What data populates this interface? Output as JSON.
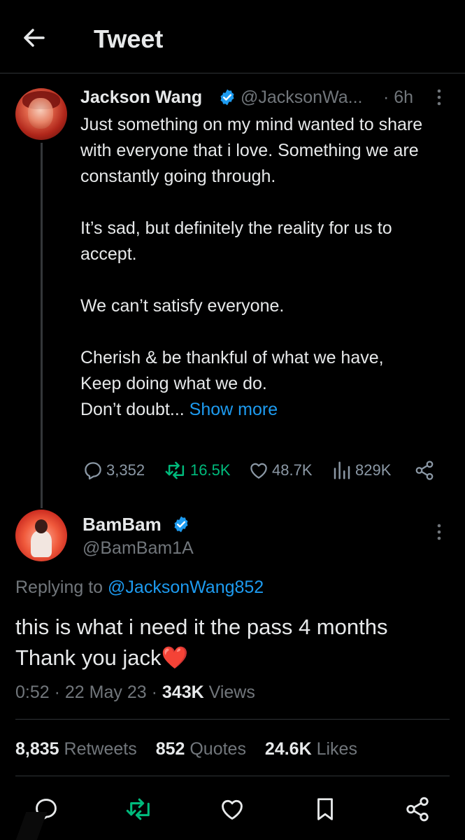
{
  "header": {
    "title": "Tweet",
    "back_icon": "arrow-left-icon"
  },
  "parent_tweet": {
    "author_name": "Jackson Wang",
    "author_handle": "@JacksonWa...",
    "time": "· 6h",
    "verified": true,
    "paragraphs": [
      "Just something on my mind wanted to share with everyone that i love. Something we are constantly going through.",
      "It’s sad, but definitely the reality for us to accept.",
      "We can’t satisfy everyone."
    ],
    "last_paragraph_lines": [
      "Cherish & be thankful of what we have,",
      "Keep doing what we do."
    ],
    "truncated_line": "Don’t doubt...",
    "show_more": "Show more",
    "actions": {
      "replies": "3,352",
      "retweets": "16.5K",
      "likes": "48.7K",
      "views": "829K"
    }
  },
  "main_tweet": {
    "author_name": "BamBam",
    "author_handle": "@BamBam1A",
    "verified": true,
    "replying_prefix": "Replying to",
    "replying_to": "@JacksonWang852",
    "text_line1": "this is what i need it the pass 4 months",
    "text_line2": "Thank you jack",
    "emoji": "❤️",
    "time": "0:52",
    "date": "22 May 23",
    "views_count": "343K",
    "views_label": "Views",
    "stats": {
      "retweets_count": "8,835",
      "retweets_label": "Retweets",
      "quotes_count": "852",
      "quotes_label": "Quotes",
      "likes_count": "24.6K",
      "likes_label": "Likes"
    }
  },
  "colors": {
    "background": "#000000",
    "text": "#e7e9ea",
    "secondary_text": "#71767b",
    "link": "#1d9bf0",
    "retweet_green": "#00ba7c",
    "verified_blue": "#1d9bf0",
    "heart_red": "#e0161c"
  }
}
